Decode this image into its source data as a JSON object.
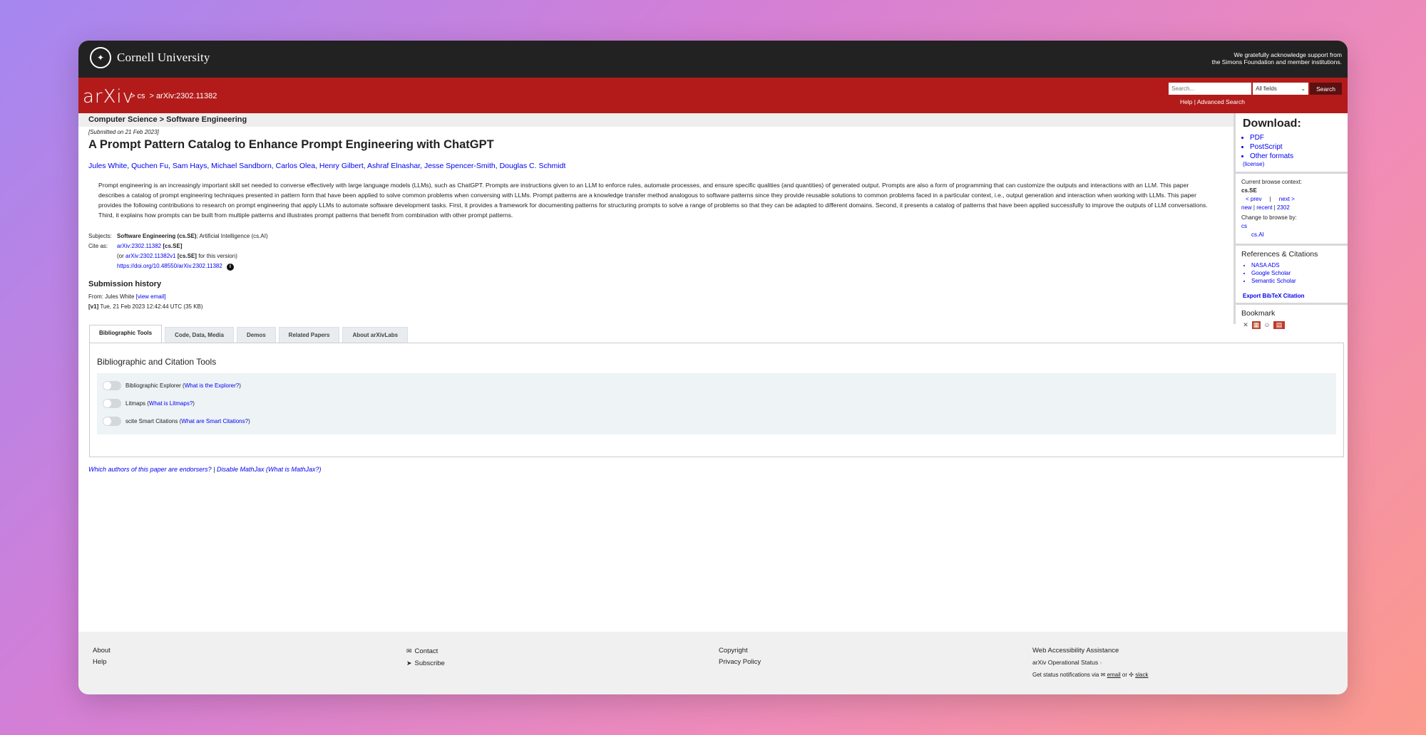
{
  "cornell": {
    "name": "Cornell University",
    "support_line1": "We gratefully acknowledge support from",
    "support_line2": "the Simons Foundation and member institutions."
  },
  "header": {
    "logo": "arXiv",
    "breadcrumb": [
      "cs",
      "arXiv:2302.11382"
    ],
    "search_placeholder": "Search...",
    "field_select": "All fields",
    "search_button": "Search",
    "help": "Help",
    "advanced": "Advanced Search"
  },
  "subheader": "Computer Science > Software Engineering",
  "paper": {
    "dateline": "[Submitted on 21 Feb 2023]",
    "title": "A Prompt Pattern Catalog to Enhance Prompt Engineering with ChatGPT",
    "authors": "Jules White, Quchen Fu, Sam Hays, Michael Sandborn, Carlos Olea, Henry Gilbert, Ashraf Elnashar, Jesse Spencer-Smith, Douglas C. Schmidt",
    "abstract": "Prompt engineering is an increasingly important skill set needed to converse effectively with large language models (LLMs), such as ChatGPT. Prompts are instructions given to an LLM to enforce rules, automate processes, and ensure specific qualities (and quantities) of generated output. Prompts are also a form of programming that can customize the outputs and interactions with an LLM. This paper describes a catalog of prompt engineering techniques presented in pattern form that have been applied to solve common problems when conversing with LLMs. Prompt patterns are a knowledge transfer method analogous to software patterns since they provide reusable solutions to common problems faced in a particular context, i.e., output generation and interaction when working with LLMs. This paper provides the following contributions to research on prompt engineering that apply LLMs to automate software development tasks. First, it provides a framework for documenting patterns for structuring prompts to solve a range of problems so that they can be adapted to different domains. Second, it presents a catalog of patterns that have been applied successfully to improve the outputs of LLM conversations. Third, it explains how prompts can be built from multiple patterns and illustrates prompt patterns that benefit from combination with other prompt patterns."
  },
  "meta": {
    "subjects_label": "Subjects:",
    "subjects_main": "Software Engineering (cs.SE)",
    "subjects_rest": "; Artificial Intelligence (cs.AI)",
    "cite_label": "Cite as:",
    "cite_id": "arXiv:2302.11382",
    "cite_tag": "[cs.SE]",
    "version_prefix": "(or",
    "version_id": "arXiv:2302.11382v1",
    "version_tag": "[cs.SE]",
    "version_suffix": "for this version)",
    "doi": "https://doi.org/10.48550/arXiv.2302.11382"
  },
  "history": {
    "title": "Submission history",
    "from": "From: Jules White",
    "view_email": "[view email]",
    "v1_label": "[v1]",
    "v1_text": "Tue, 21 Feb 2023 12:42:44 UTC (35 KB)"
  },
  "tabs": [
    "Bibliographic Tools",
    "Code, Data, Media",
    "Demos",
    "Related Papers",
    "About arXivLabs"
  ],
  "panel": {
    "title": "Bibliographic and Citation Tools",
    "tools": [
      {
        "name": "Bibliographic Explorer",
        "link": "What is the Explorer?"
      },
      {
        "name": "Litmaps",
        "link": "What is Litmaps?"
      },
      {
        "name": "scite Smart Citations",
        "link": "What are Smart Citations?"
      }
    ]
  },
  "endorsers": {
    "q": "Which authors of this paper are endorsers?",
    "sep": "|",
    "mathjax": "Disable MathJax",
    "what": "(What is MathJax?)"
  },
  "sidebar": {
    "download_title": "Download:",
    "downloads": [
      "PDF",
      "PostScript",
      "Other formats"
    ],
    "license": "(license)",
    "context_label": "Current browse context:",
    "context": "cs.SE",
    "prev": "< prev",
    "sep": "|",
    "next": "next >",
    "new": "new",
    "recent": "recent",
    "month": "2302",
    "change_label": "Change to browse by:",
    "browse": [
      "cs",
      "cs.AI"
    ],
    "refs_title": "References & Citations",
    "refs": [
      "NASA ADS",
      "Google Scholar",
      "Semantic Scholar"
    ],
    "bibtex": "Export BibTeX Citation",
    "bookmark": "Bookmark"
  },
  "footer": {
    "about": "About",
    "help": "Help",
    "contact": "Contact",
    "subscribe": "Subscribe",
    "copyright": "Copyright",
    "privacy": "Privacy Policy",
    "accessibility": "Web Accessibility Assistance",
    "status": "arXiv Operational Status",
    "notify": "Get status notifications via",
    "email": "email",
    "or": "or",
    "slack": "slack"
  }
}
